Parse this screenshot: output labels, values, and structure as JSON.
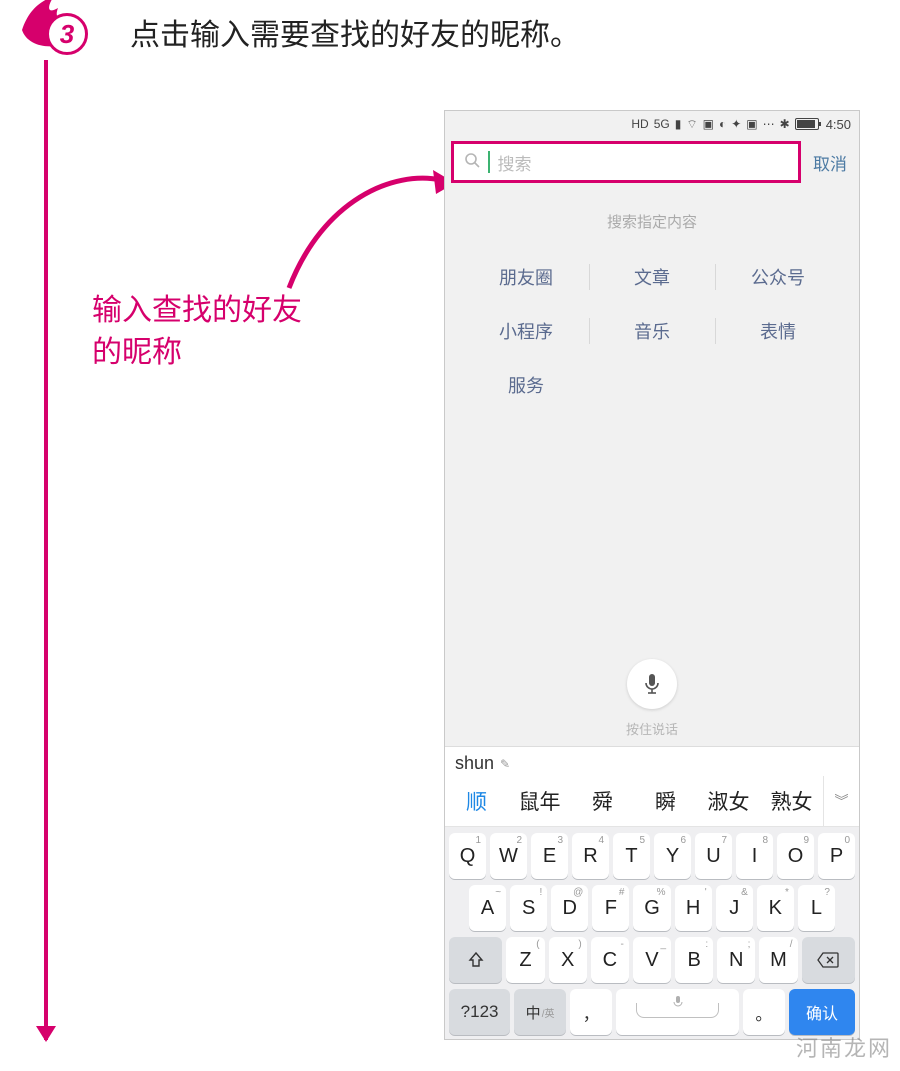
{
  "step": {
    "number": "3",
    "title": "点击输入需要查找的好友的昵称。"
  },
  "callout": {
    "line1": "输入查找的好友",
    "line2": "的昵称"
  },
  "statusbar": {
    "icons": [
      "HD",
      "5G",
      "wifi",
      "camera",
      "globe",
      "chat",
      "alipay",
      "app",
      "more",
      "bluetooth"
    ],
    "time": "4:50"
  },
  "search": {
    "placeholder": "搜索",
    "cancel": "取消",
    "section_title": "搜索指定内容"
  },
  "categories": {
    "row1": [
      "朋友圈",
      "文章",
      "公众号"
    ],
    "row2": [
      "小程序",
      "音乐",
      "表情"
    ],
    "row3": [
      "服务"
    ]
  },
  "voice": {
    "hint": "按住说话"
  },
  "ime": {
    "composing": "shun",
    "candidates": [
      "顺",
      "鼠年",
      "舜",
      "瞬",
      "淑女",
      "熟女"
    ]
  },
  "keyboard": {
    "row1": [
      {
        "k": "Q",
        "s": "1"
      },
      {
        "k": "W",
        "s": "2"
      },
      {
        "k": "E",
        "s": "3"
      },
      {
        "k": "R",
        "s": "4"
      },
      {
        "k": "T",
        "s": "5"
      },
      {
        "k": "Y",
        "s": "6"
      },
      {
        "k": "U",
        "s": "7"
      },
      {
        "k": "I",
        "s": "8"
      },
      {
        "k": "O",
        "s": "9"
      },
      {
        "k": "P",
        "s": "0"
      }
    ],
    "row2": [
      {
        "k": "A",
        "s": "~"
      },
      {
        "k": "S",
        "s": "!"
      },
      {
        "k": "D",
        "s": "@"
      },
      {
        "k": "F",
        "s": "#"
      },
      {
        "k": "G",
        "s": "%"
      },
      {
        "k": "H",
        "s": "'"
      },
      {
        "k": "J",
        "s": "&"
      },
      {
        "k": "K",
        "s": "*"
      },
      {
        "k": "L",
        "s": "?"
      }
    ],
    "row3": [
      {
        "k": "Z",
        "s": "("
      },
      {
        "k": "X",
        "s": ")"
      },
      {
        "k": "C",
        "s": "-"
      },
      {
        "k": "V",
        "s": "_"
      },
      {
        "k": "B",
        "s": ":"
      },
      {
        "k": "N",
        "s": ";"
      },
      {
        "k": "M",
        "s": "/"
      }
    ],
    "fn": {
      "numbers": "?123",
      "lang_main": "中",
      "lang_sub": "/英",
      "comma": "，",
      "period": "。",
      "enter": "确认"
    }
  },
  "watermark": "河南龙网"
}
